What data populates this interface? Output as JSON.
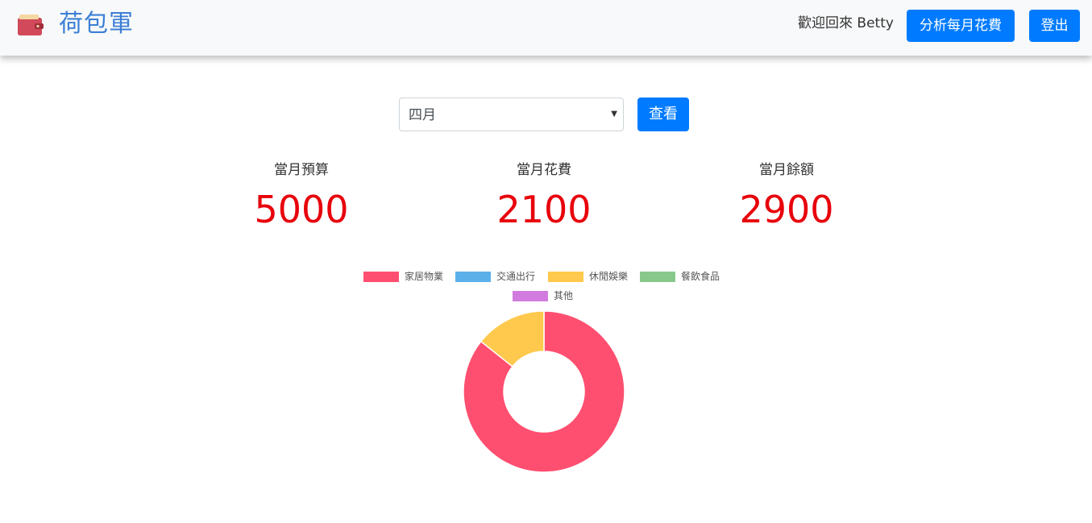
{
  "header": {
    "brand": "荷包軍",
    "welcome": "歡迎回來 Betty",
    "analyze_label": "分析每月花費",
    "logout_label": "登出"
  },
  "filter": {
    "month_selected": "四月",
    "view_label": "查看"
  },
  "stats": {
    "budget_label": "當月預算",
    "budget_value": "5000",
    "spent_label": "當月花費",
    "spent_value": "2100",
    "balance_label": "當月餘額",
    "balance_value": "2900"
  },
  "colors": {
    "accent": "#007bff",
    "value_red": "#e8000b"
  },
  "chart_data": {
    "type": "pie",
    "variant": "doughnut",
    "categories": [
      "家居物業",
      "交通出行",
      "休閒娛樂",
      "餐飲食品",
      "其他"
    ],
    "values": [
      1800,
      0,
      300,
      0,
      0
    ],
    "colors": [
      "#ff4f70",
      "#5cb0ea",
      "#ffc94d",
      "#88c98b",
      "#d27bdf"
    ],
    "legend_position": "top"
  }
}
